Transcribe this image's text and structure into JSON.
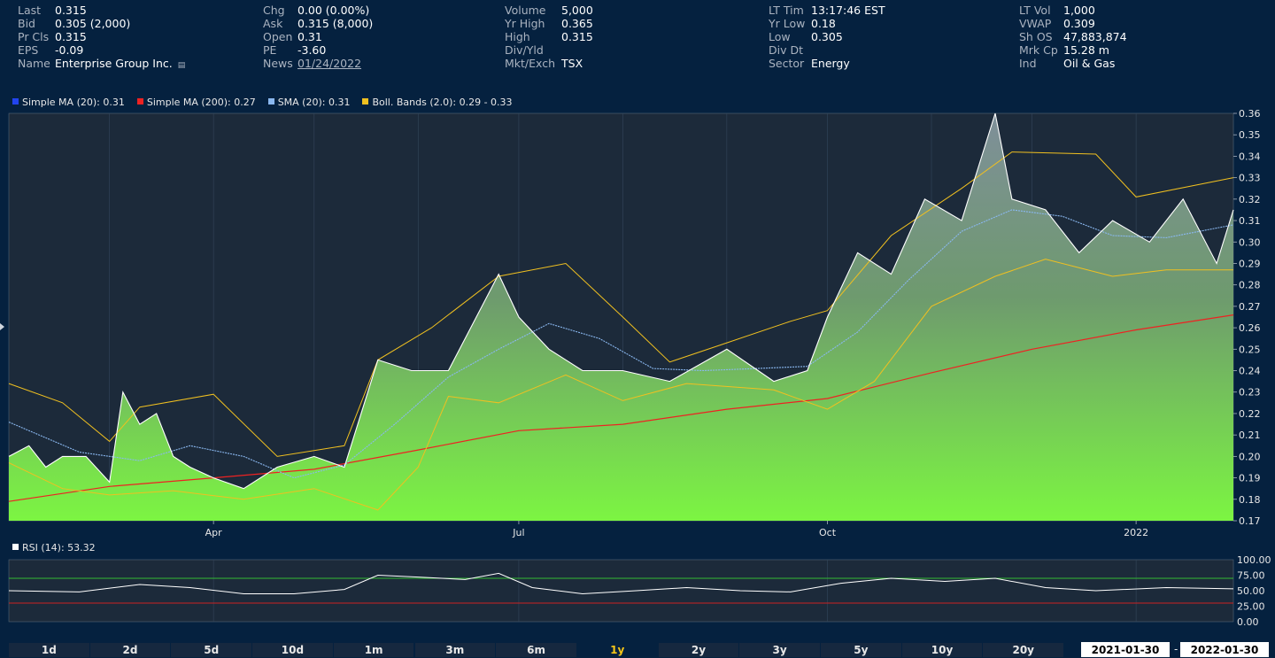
{
  "quote": {
    "columns": [
      {
        "label_width": 42,
        "rows": [
          {
            "label": "Last",
            "value": "0.315"
          },
          {
            "label": "Bid",
            "value": "0.305 (2,000)"
          },
          {
            "label": "Pr Cls",
            "value": "0.315"
          },
          {
            "label": "EPS",
            "value": "-0.09"
          },
          {
            "label": "Name",
            "value": "Enterprise Group Inc."
          }
        ]
      },
      {
        "label_width": 39,
        "rows": [
          {
            "label": "Chg",
            "value": "0.00 (0.00%)"
          },
          {
            "label": "Ask",
            "value": "0.315 (8,000)"
          },
          {
            "label": "Open",
            "value": "0.31"
          },
          {
            "label": "PE",
            "value": "-3.60"
          },
          {
            "label": "News",
            "value": "01/24/2022",
            "link": true
          }
        ]
      },
      {
        "label_width": 64,
        "rows": [
          {
            "label": "Volume",
            "value": "5,000"
          },
          {
            "label": "Yr High",
            "value": "0.365"
          },
          {
            "label": "High",
            "value": "0.315"
          },
          {
            "label": "Div/Yld",
            "value": ""
          },
          {
            "label": "Mkt/Exch",
            "value": "TSX"
          }
        ]
      },
      {
        "label_width": 48,
        "rows": [
          {
            "label": "LT Tim",
            "value": "13:17:46 EST"
          },
          {
            "label": "Yr Low",
            "value": "0.18"
          },
          {
            "label": "Low",
            "value": "0.305"
          },
          {
            "label": "Div Dt",
            "value": ""
          },
          {
            "label": "Sector",
            "value": "Energy"
          }
        ]
      },
      {
        "label_width": 50,
        "rows": [
          {
            "label": "LT Vol",
            "value": "1,000"
          },
          {
            "label": "VWAP",
            "value": "0.309"
          },
          {
            "label": "Sh OS",
            "value": "47,883,874"
          },
          {
            "label": "Mrk Cp",
            "value": "15.28 m"
          },
          {
            "label": "Ind",
            "value": "Oil & Gas"
          }
        ]
      }
    ],
    "name_icon": "chart-icon"
  },
  "legend": [
    {
      "label": "Simple MA (20): 0.31",
      "color": "#2244ee"
    },
    {
      "label": "Simple MA (200): 0.27",
      "color": "#ee2222"
    },
    {
      "label": "SMA (20): 0.31",
      "color": "#8ab8f0"
    },
    {
      "label": "Boll. Bands (2.0): 0.29 - 0.33",
      "color": "#f0c020"
    }
  ],
  "rsi_legend": {
    "label": "RSI (14): 53.32",
    "color": "#ffffff"
  },
  "chart_data": [
    {
      "type": "line",
      "x_start": "2021-01-30",
      "x_end": "2022-01-30",
      "x_tick_labels": [
        "Apr",
        "Jul",
        "Oct",
        "2022"
      ],
      "x_tick_dates": [
        "2021-04-01",
        "2021-07-01",
        "2021-10-01",
        "2022-01-01"
      ],
      "ylim": [
        0.17,
        0.36
      ],
      "y_ticks": [
        "0.36",
        "0.35",
        "0.34",
        "0.33",
        "0.32",
        "0.31",
        "0.30",
        "0.29",
        "0.28",
        "0.27",
        "0.26",
        "0.25",
        "0.24",
        "0.23",
        "0.22",
        "0.21",
        "0.20",
        "0.19",
        "0.18",
        "0.17"
      ],
      "grid": true,
      "series": [
        {
          "name": "Simple MA (200)",
          "color": "#ee2222",
          "points": [
            [
              "2021-01-30",
              0.179
            ],
            [
              "2021-03-01",
              0.186
            ],
            [
              "2021-04-01",
              0.19
            ],
            [
              "2021-05-01",
              0.194
            ],
            [
              "2021-06-01",
              0.203
            ],
            [
              "2021-07-01",
              0.212
            ],
            [
              "2021-08-01",
              0.215
            ],
            [
              "2021-09-01",
              0.222
            ],
            [
              "2021-10-01",
              0.227
            ],
            [
              "2021-11-01",
              0.239
            ],
            [
              "2021-12-01",
              0.25
            ],
            [
              "2022-01-01",
              0.259
            ],
            [
              "2022-01-30",
              0.266
            ]
          ]
        },
        {
          "name": "SMA (20)",
          "color": "#8ab8f0",
          "points": [
            [
              "2021-01-30",
              0.216
            ],
            [
              "2021-02-20",
              0.202
            ],
            [
              "2021-03-10",
              0.198
            ],
            [
              "2021-03-25",
              0.205
            ],
            [
              "2021-04-10",
              0.2
            ],
            [
              "2021-04-25",
              0.19
            ],
            [
              "2021-05-10",
              0.196
            ],
            [
              "2021-05-25",
              0.215
            ],
            [
              "2021-06-10",
              0.237
            ],
            [
              "2021-06-25",
              0.25
            ],
            [
              "2021-07-10",
              0.262
            ],
            [
              "2021-07-25",
              0.255
            ],
            [
              "2021-08-10",
              0.241
            ],
            [
              "2021-08-25",
              0.24
            ],
            [
              "2021-09-10",
              0.241
            ],
            [
              "2021-09-25",
              0.242
            ],
            [
              "2021-10-10",
              0.258
            ],
            [
              "2021-10-25",
              0.282
            ],
            [
              "2021-11-10",
              0.305
            ],
            [
              "2021-11-25",
              0.315
            ],
            [
              "2021-12-10",
              0.312
            ],
            [
              "2021-12-25",
              0.303
            ],
            [
              "2022-01-10",
              0.302
            ],
            [
              "2022-01-30",
              0.308
            ]
          ]
        },
        {
          "name": "Boll. Bands upper",
          "color": "#f0c020",
          "points": [
            [
              "2021-01-30",
              0.234
            ],
            [
              "2021-02-15",
              0.225
            ],
            [
              "2021-03-01",
              0.207
            ],
            [
              "2021-03-10",
              0.223
            ],
            [
              "2021-04-01",
              0.229
            ],
            [
              "2021-04-20",
              0.2
            ],
            [
              "2021-05-10",
              0.205
            ],
            [
              "2021-05-20",
              0.245
            ],
            [
              "2021-06-05",
              0.26
            ],
            [
              "2021-06-25",
              0.284
            ],
            [
              "2021-07-15",
              0.29
            ],
            [
              "2021-08-01",
              0.265
            ],
            [
              "2021-08-15",
              0.244
            ],
            [
              "2021-09-01",
              0.253
            ],
            [
              "2021-09-20",
              0.263
            ],
            [
              "2021-10-01",
              0.268
            ],
            [
              "2021-10-20",
              0.303
            ],
            [
              "2021-11-10",
              0.325
            ],
            [
              "2021-11-25",
              0.342
            ],
            [
              "2021-12-20",
              0.341
            ],
            [
              "2022-01-01",
              0.321
            ],
            [
              "2022-01-30",
              0.33
            ]
          ]
        },
        {
          "name": "Boll. Bands lower",
          "color": "#f0c020",
          "points": [
            [
              "2021-01-30",
              0.197
            ],
            [
              "2021-02-15",
              0.185
            ],
            [
              "2021-03-01",
              0.182
            ],
            [
              "2021-03-20",
              0.184
            ],
            [
              "2021-04-10",
              0.18
            ],
            [
              "2021-05-01",
              0.185
            ],
            [
              "2021-05-20",
              0.175
            ],
            [
              "2021-06-01",
              0.195
            ],
            [
              "2021-06-10",
              0.228
            ],
            [
              "2021-06-25",
              0.225
            ],
            [
              "2021-07-15",
              0.238
            ],
            [
              "2021-08-01",
              0.226
            ],
            [
              "2021-08-20",
              0.234
            ],
            [
              "2021-09-15",
              0.231
            ],
            [
              "2021-10-01",
              0.222
            ],
            [
              "2021-10-15",
              0.235
            ],
            [
              "2021-11-01",
              0.27
            ],
            [
              "2021-11-20",
              0.284
            ],
            [
              "2021-12-05",
              0.292
            ],
            [
              "2021-12-25",
              0.284
            ],
            [
              "2022-01-10",
              0.287
            ],
            [
              "2022-01-30",
              0.287
            ]
          ]
        },
        {
          "name": "Price",
          "color": "#ffffff",
          "fill": "area",
          "points": [
            [
              "2021-01-30",
              0.2
            ],
            [
              "2021-02-05",
              0.205
            ],
            [
              "2021-02-10",
              0.195
            ],
            [
              "2021-02-15",
              0.2
            ],
            [
              "2021-02-22",
              0.2
            ],
            [
              "2021-03-01",
              0.188
            ],
            [
              "2021-03-05",
              0.23
            ],
            [
              "2021-03-10",
              0.215
            ],
            [
              "2021-03-15",
              0.22
            ],
            [
              "2021-03-20",
              0.2
            ],
            [
              "2021-03-25",
              0.195
            ],
            [
              "2021-04-01",
              0.19
            ],
            [
              "2021-04-10",
              0.185
            ],
            [
              "2021-04-20",
              0.195
            ],
            [
              "2021-05-01",
              0.2
            ],
            [
              "2021-05-10",
              0.195
            ],
            [
              "2021-05-20",
              0.245
            ],
            [
              "2021-05-30",
              0.24
            ],
            [
              "2021-06-10",
              0.24
            ],
            [
              "2021-06-20",
              0.27
            ],
            [
              "2021-06-25",
              0.285
            ],
            [
              "2021-07-01",
              0.265
            ],
            [
              "2021-07-10",
              0.25
            ],
            [
              "2021-07-20",
              0.24
            ],
            [
              "2021-08-01",
              0.24
            ],
            [
              "2021-08-15",
              0.235
            ],
            [
              "2021-09-01",
              0.25
            ],
            [
              "2021-09-15",
              0.235
            ],
            [
              "2021-09-25",
              0.24
            ],
            [
              "2021-10-01",
              0.265
            ],
            [
              "2021-10-10",
              0.295
            ],
            [
              "2021-10-20",
              0.285
            ],
            [
              "2021-10-30",
              0.32
            ],
            [
              "2021-11-10",
              0.31
            ],
            [
              "2021-11-20",
              0.36
            ],
            [
              "2021-11-25",
              0.32
            ],
            [
              "2021-12-05",
              0.315
            ],
            [
              "2021-12-15",
              0.295
            ],
            [
              "2021-12-25",
              0.31
            ],
            [
              "2022-01-05",
              0.3
            ],
            [
              "2022-01-15",
              0.32
            ],
            [
              "2022-01-25",
              0.29
            ],
            [
              "2022-01-30",
              0.315
            ]
          ]
        }
      ]
    },
    {
      "type": "line",
      "ylim": [
        0,
        100
      ],
      "y_ticks": [
        "100.00",
        "75.00",
        "50.00",
        "25.00",
        "0.00"
      ],
      "overbought": 70,
      "oversold": 30,
      "series": [
        {
          "name": "RSI (14)",
          "color": "#ffffff",
          "points": [
            [
              "2021-01-30",
              50
            ],
            [
              "2021-02-20",
              48
            ],
            [
              "2021-03-10",
              60
            ],
            [
              "2021-03-25",
              55
            ],
            [
              "2021-04-10",
              45
            ],
            [
              "2021-04-25",
              45
            ],
            [
              "2021-05-10",
              52
            ],
            [
              "2021-05-20",
              75
            ],
            [
              "2021-06-01",
              72
            ],
            [
              "2021-06-15",
              68
            ],
            [
              "2021-06-25",
              78
            ],
            [
              "2021-07-05",
              55
            ],
            [
              "2021-07-20",
              45
            ],
            [
              "2021-08-05",
              50
            ],
            [
              "2021-08-20",
              55
            ],
            [
              "2021-09-05",
              50
            ],
            [
              "2021-09-20",
              48
            ],
            [
              "2021-10-05",
              62
            ],
            [
              "2021-10-20",
              70
            ],
            [
              "2021-11-05",
              65
            ],
            [
              "2021-11-20",
              70
            ],
            [
              "2021-12-05",
              55
            ],
            [
              "2021-12-20",
              50
            ],
            [
              "2022-01-10",
              55
            ],
            [
              "2022-01-30",
              53
            ]
          ]
        }
      ]
    }
  ],
  "range_buttons": [
    {
      "label": "1d"
    },
    {
      "label": "2d"
    },
    {
      "label": "5d"
    },
    {
      "label": "10d"
    },
    {
      "label": "1m"
    },
    {
      "label": "3m"
    },
    {
      "label": "6m"
    },
    {
      "label": "1y",
      "active": true
    },
    {
      "label": "2y"
    },
    {
      "label": "3y"
    },
    {
      "label": "5y"
    },
    {
      "label": "10y"
    },
    {
      "label": "20y"
    }
  ],
  "date_range": {
    "start": "2021-01-30",
    "separator": "-",
    "end": "2022-01-30"
  }
}
